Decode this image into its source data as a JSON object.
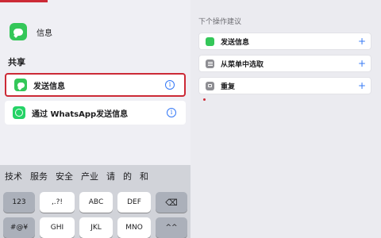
{
  "left": {
    "messages_label": "信息",
    "section_title": "共享",
    "actions": [
      {
        "label": "发送信息",
        "icon": "messages-icon"
      },
      {
        "label": "通过 WhatsApp发送信息",
        "icon": "whatsapp-icon"
      }
    ],
    "info_glyph": "i"
  },
  "keyboard": {
    "suggestions": [
      "技术",
      "服务",
      "安全",
      "产业",
      "请",
      "的",
      "和"
    ],
    "chevron": "⌄",
    "row1": [
      "123",
      ",.?!",
      "ABC",
      "DEF",
      "⌫"
    ],
    "row2": [
      "#@¥",
      "GHI",
      "JKL",
      "MNO",
      "^^"
    ]
  },
  "right": {
    "title": "下个操作建议",
    "suggestions": [
      {
        "label": "发送信息",
        "icon": "messages-icon"
      },
      {
        "label": "从菜单中选取",
        "icon": "menu-icon"
      },
      {
        "label": "重复",
        "icon": "repeat-icon"
      }
    ],
    "plus": "+"
  },
  "colors": {
    "accent": "#3478f6",
    "highlight": "#cc2a36",
    "messages_green": "#34c759"
  }
}
